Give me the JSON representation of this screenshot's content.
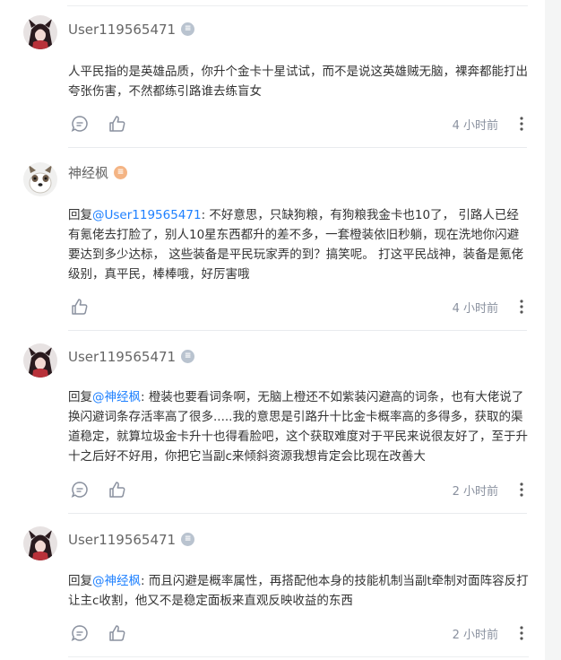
{
  "comments": [
    {
      "username": "User119565471",
      "badge": "gray",
      "content": "人平民指的是英雄品质，你升个金卡十星试试，而不是说这英雄贼无脑，裸奔都能打出夸张伤害，不然都练引路谁去练盲女",
      "reply_prefix": "",
      "mention": "",
      "time": "4 小时前",
      "has_comment_icon": true
    },
    {
      "username": "神经枫",
      "badge": "orange",
      "reply_prefix": "回复",
      "mention": "@User119565471",
      "content": ": 不好意思，只缺狗粮，有狗粮我金卡也10了，  引路人已经有氪佬去打脸了，别人10星东西都升的差不多，一套橙装依旧秒躺，现在洗地你闪避要达到多少达标，  这些装备是平民玩家弄的到？搞笑呢。 打这平民战神，装备是氪佬级别，真平民，棒棒哦，好厉害哦",
      "time": "4 小时前",
      "has_comment_icon": false
    },
    {
      "username": "User119565471",
      "badge": "gray",
      "reply_prefix": "回复",
      "mention": "@神经枫",
      "content": ": 橙装也要看词条啊，无脑上橙还不如紫装闪避高的词条，也有大佬说了换闪避词条存活率高了很多.....我的意思是引路升十比金卡概率高的多得多，获取的渠道稳定，就算垃圾金卡升十也得看脸吧，这个获取难度对于平民来说很友好了，至于升十之后好不好用，你把它当副c来倾斜资源我想肯定会比现在改善大",
      "time": "2 小时前",
      "has_comment_icon": true
    },
    {
      "username": "User119565471",
      "badge": "gray",
      "reply_prefix": "回复",
      "mention": "@神经枫",
      "content": ": 而且闪避是概率属性，再搭配他本身的技能机制当副t牵制对面阵容反打让主c收割，他又不是稳定面板来直观反映收益的东西",
      "time": "2 小时前",
      "has_comment_icon": true
    }
  ]
}
